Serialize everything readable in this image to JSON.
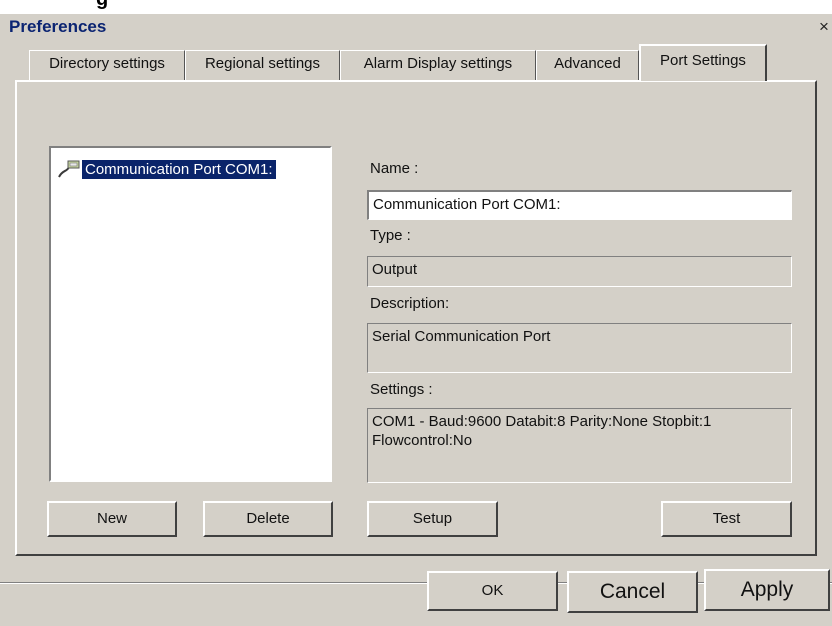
{
  "window": {
    "title": "Preferences",
    "close_glyph": "×"
  },
  "top_clip": {
    "text": "g",
    "_note": "partial glyph visible at the very top edge of the screenshot"
  },
  "tabs": [
    {
      "label": "Directory settings",
      "active": false
    },
    {
      "label": "Regional settings",
      "active": false
    },
    {
      "label": "Alarm Display settings",
      "active": false
    },
    {
      "label": "Advanced",
      "active": false
    },
    {
      "label": "Port Settings",
      "active": true
    }
  ],
  "port_list": {
    "items": [
      {
        "label": "Communication Port COM1:",
        "icon": "serial-port-icon",
        "selected": true
      }
    ]
  },
  "details": {
    "name_label": "Name :",
    "name_value": "Communication Port COM1:",
    "type_label": "Type :",
    "type_value": "Output",
    "description_label": "Description:",
    "description_value": "Serial Communication Port",
    "settings_label": "Settings :",
    "settings_value": "COM1 - Baud:9600 Databit:8 Parity:None Stopbit:1 Flowcontrol:No"
  },
  "buttons": {
    "new": "New",
    "delete": "Delete",
    "setup": "Setup",
    "test": "Test",
    "ok": "OK",
    "cancel": "Cancel",
    "apply": "Apply"
  },
  "colors": {
    "face": "#d4d0c8",
    "selection": "#0a246a",
    "title_text": "#0b2472"
  }
}
